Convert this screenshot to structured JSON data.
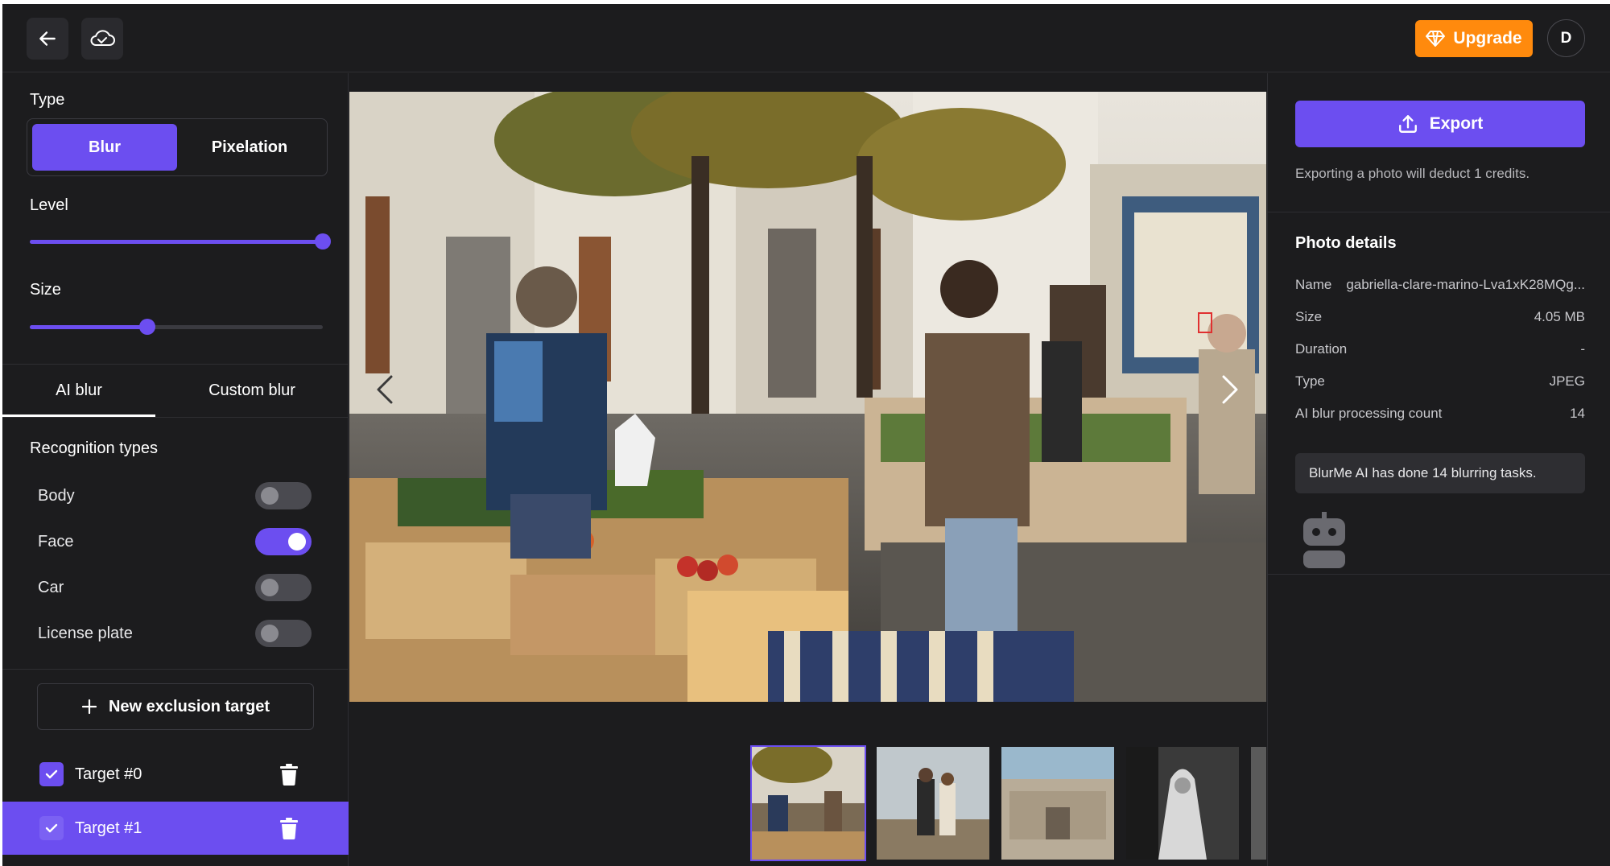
{
  "topbar": {
    "back_icon": "arrow-left-icon",
    "cloud_icon": "cloud-check-icon",
    "upgrade_label": "Upgrade",
    "upgrade_icon": "diamond-icon",
    "avatar_initial": "D"
  },
  "left": {
    "type_label": "Type",
    "type_options": [
      "Blur",
      "Pixelation"
    ],
    "type_selected": "Blur",
    "level_label": "Level",
    "level_value": 1.0,
    "size_label": "Size",
    "size_value": 0.4,
    "tabs": [
      "AI blur",
      "Custom blur"
    ],
    "active_tab": "AI blur",
    "recognition_label": "Recognition types",
    "recognition": [
      {
        "label": "Body",
        "on": false
      },
      {
        "label": "Face",
        "on": true
      },
      {
        "label": "Car",
        "on": false
      },
      {
        "label": "License plate",
        "on": false
      }
    ],
    "new_target_label": "New exclusion target",
    "targets": [
      {
        "label": "Target #0",
        "checked": true,
        "selected": false
      },
      {
        "label": "Target #1",
        "checked": true,
        "selected": true
      }
    ]
  },
  "center": {
    "nav_prev_icon": "chevron-left-icon",
    "nav_next_icon": "chevron-right-icon",
    "thumbnail_count": 5,
    "active_thumbnail": 0
  },
  "right": {
    "export_label": "Export",
    "export_icon": "upload-icon",
    "export_note": "Exporting a photo will deduct 1 credits.",
    "details_title": "Photo details",
    "details": [
      {
        "label": "Name",
        "value": "gabriella-clare-marino-Lva1xK28MQg..."
      },
      {
        "label": "Size",
        "value": "4.05 MB"
      },
      {
        "label": "Duration",
        "value": "-"
      },
      {
        "label": "Type",
        "value": "JPEG"
      },
      {
        "label": "AI blur processing count",
        "value": "14"
      }
    ],
    "assistant_message": "BlurMe AI has done 14 blurring tasks.",
    "assistant_icon": "robot-icon"
  },
  "colors": {
    "accent": "#6c4ef0",
    "upgrade": "#ff8a0d",
    "background": "#1c1c1e"
  }
}
